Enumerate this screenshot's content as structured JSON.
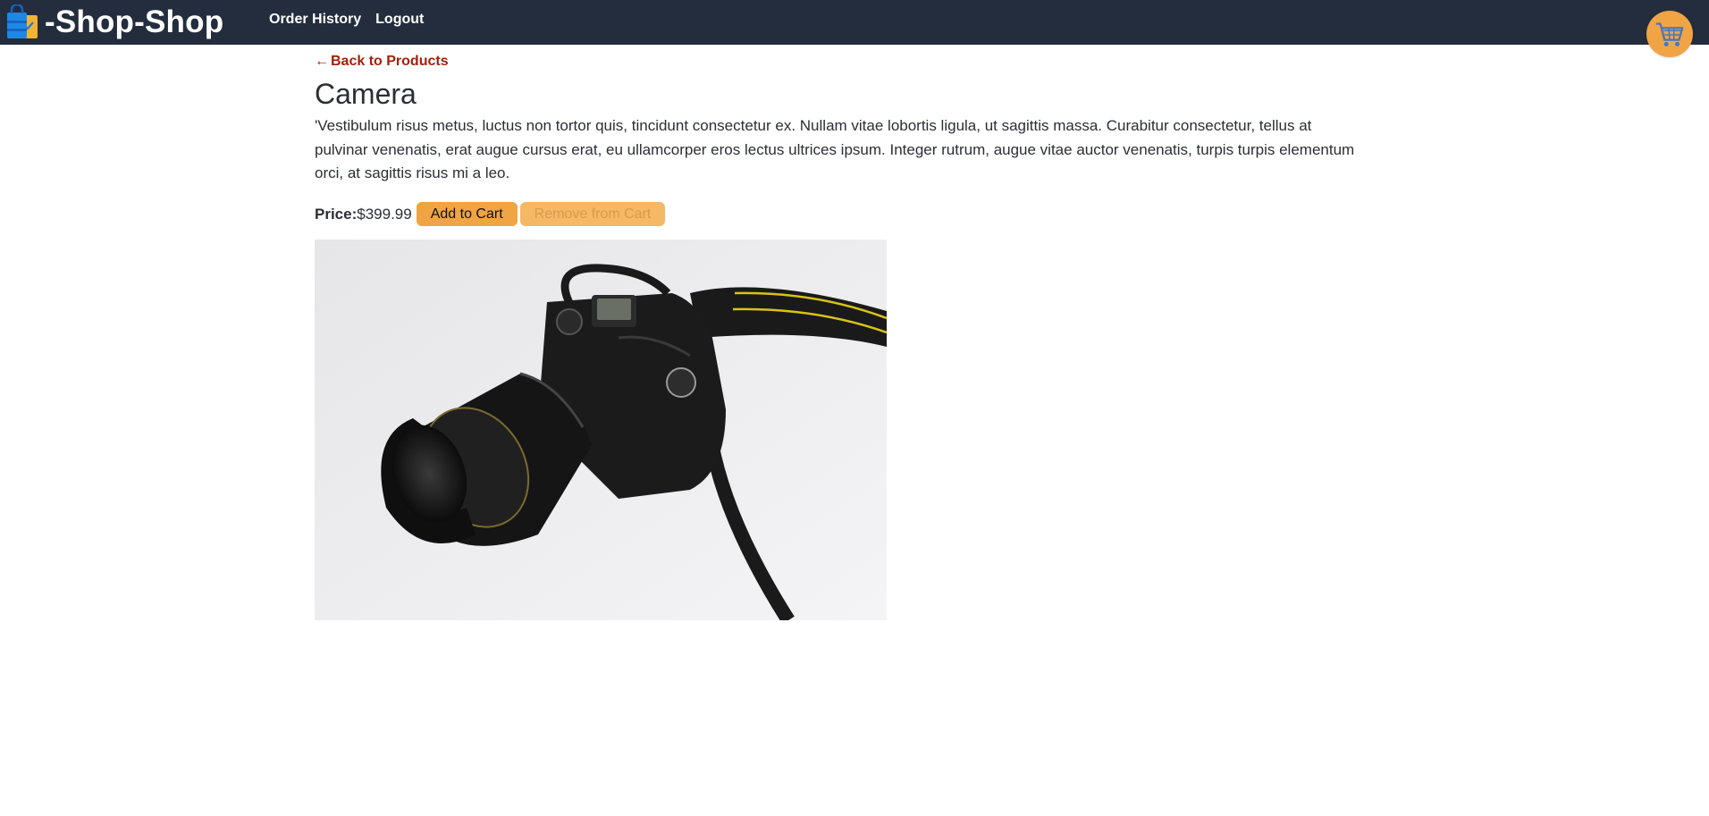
{
  "header": {
    "brand": "-Shop-Shop",
    "nav": [
      {
        "label": "Order History"
      },
      {
        "label": "Logout"
      }
    ]
  },
  "product": {
    "back_link": "Back to Products",
    "back_arrow": "←",
    "name": "Camera",
    "description": "'Vestibulum risus metus, luctus non tortor quis, tincidunt consectetur ex. Nullam vitae lobortis ligula, ut sagittis massa. Curabitur consectetur, tellus at pulvinar venenatis, erat augue cursus erat, eu ullamcorper eros lectus ultrices ipsum. Integer rutrum, augue vitae auctor venenatis, turpis turpis elementum orci, at sagittis risus mi a leo.",
    "price_label": "Price:",
    "price": "$399.99",
    "add_to_cart": "Add to Cart",
    "remove_from_cart": "Remove from Cart",
    "remove_enabled": false
  },
  "colors": {
    "navbar_bg": "#232d3d",
    "accent": "#f0a444",
    "back_link": "#a3210a"
  },
  "icons": {
    "brand": "shopping-bag-icon",
    "cart": "shopping-cart-icon"
  }
}
